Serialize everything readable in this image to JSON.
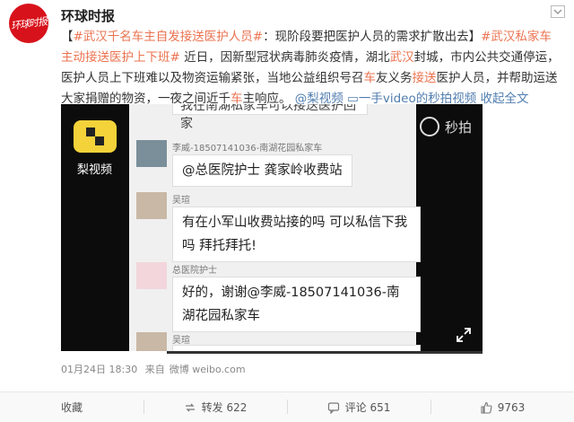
{
  "account": {
    "name": "环球时报",
    "avatar_text": "环球时报"
  },
  "post": {
    "tag1": "#武汉千名车主自发接送医护人员#",
    "text1": "：现阶段要把医护人员的需求扩散出去】",
    "tag2": "#武汉私家车主动接送医护上下班#",
    "text2": " 近日，因新型冠状病毒肺炎疫情，湖北",
    "word_wuhan": "武汉",
    "text3": "封城，市内公共交通停运，医护人员上下班难以及物资运输紧张，当地公益组织号召",
    "word_che": "车",
    "text4": "友义务",
    "word_jiesong": "接送",
    "text5": "医护人员，并帮助运送大家捐赠的物资，一夜之间近千",
    "word_che2": "车",
    "text6": "主响应。",
    "link_lishi": "@梨视频",
    "link_video": "一手video的秒拍视频",
    "link_more": "收起全文"
  },
  "video": {
    "source_logo_label": "梨视频",
    "watermark": "秒拍",
    "progress": 0.25,
    "chat": {
      "cropped_line": "我在南湖私家车可以接送医护回家",
      "msg1_name": "李威-18507141036-南湖花园私家车",
      "msg1_text": "@总医院护士  龚家岭收费站",
      "msg2_name": "吴瑄",
      "msg2_text": "有在小军山收费站接的吗 可以私信下我吗 拜托拜托!",
      "msg3_name": "总医院护士",
      "msg3_text": "好的，谢谢@李威-18507141036-南湖花园私家车",
      "msg4_name": "吴瑄"
    }
  },
  "meta": {
    "date": "01月24日 18:30",
    "source_prefix": "来自",
    "source": "微博 weibo.com"
  },
  "actions": {
    "collect": "收藏",
    "repost": "转发 622",
    "comment": "评论 651",
    "like": "9763"
  }
}
